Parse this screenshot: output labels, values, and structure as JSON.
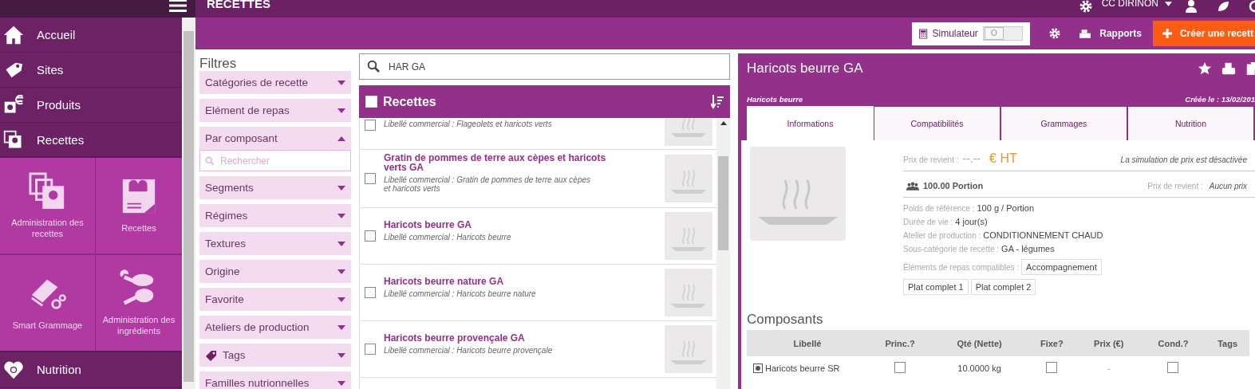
{
  "topbar": {
    "section_title": "RECETTES",
    "site": "CC DIRINON"
  },
  "sidebar": {
    "items": [
      {
        "label": "Accueil",
        "selected": false
      },
      {
        "label": "Sites",
        "selected": false
      },
      {
        "label": "Produits",
        "selected": false
      },
      {
        "label": "Recettes",
        "selected": true
      }
    ],
    "tiles": [
      {
        "label": "Administration des recettes"
      },
      {
        "label": "Recettes"
      },
      {
        "label": "Smart Grammage"
      },
      {
        "label": "Administration des ingrédients"
      }
    ],
    "bottom_items": [
      {
        "label": "Nutrition",
        "selected": false
      }
    ]
  },
  "toolbar": {
    "simulator": {
      "label": "Simulateur",
      "toggle_text": "O",
      "on": false
    },
    "reports": "Rapports",
    "create": "Créer une recett"
  },
  "filters": {
    "title": "Filtres",
    "items": [
      {
        "kind": "plain",
        "label": "Catégories de recette",
        "expanded": false
      },
      {
        "kind": "plain",
        "label": "Elément de repas",
        "expanded": false
      },
      {
        "kind": "plain",
        "label": "Par composant",
        "expanded": true,
        "search_placeholder": "Rechercher"
      },
      {
        "kind": "plain",
        "label": "Segments",
        "expanded": false
      },
      {
        "kind": "plain",
        "label": "Régimes",
        "expanded": false
      },
      {
        "kind": "plain",
        "label": "Textures",
        "expanded": false
      },
      {
        "kind": "plain",
        "label": "Origine",
        "expanded": false
      },
      {
        "kind": "plain",
        "label": "Favorite",
        "expanded": false
      },
      {
        "kind": "plain",
        "label": "Ateliers de production",
        "expanded": false
      },
      {
        "kind": "tag",
        "label": "Tags",
        "expanded": false
      },
      {
        "kind": "plain",
        "label": "Familles nutrionnelles",
        "expanded": false
      }
    ]
  },
  "recipes": {
    "search_value": "HAR GA",
    "title": "Recettes",
    "all_checked": false,
    "rows": [
      {
        "kind": "partial",
        "subtitle": "Libellé commercial : Flageolets et haricots verts",
        "checked": false
      },
      {
        "kind": "full",
        "name": "Gratin de pommes de terre aux cèpes et haricots verts GA",
        "subtitle": "Libellé commercial : Gratin de pommes de terre aux cèpes et haricots verts",
        "checked": false
      },
      {
        "kind": "full",
        "name": "Haricots beurre GA",
        "subtitle": "Libellé commercial : Haricots beurre",
        "checked": false
      },
      {
        "kind": "full",
        "name": "Haricots beurre nature GA",
        "subtitle": "Libellé commercial : Haricots beurre nature",
        "checked": false
      },
      {
        "kind": "full",
        "name": "Haricots beurre provençale GA",
        "subtitle": "Libellé commercial : Haricots beurre provençale",
        "checked": false
      }
    ]
  },
  "detail": {
    "title": "Haricots beurre GA",
    "subtitle": "Haricots beurre",
    "created": "Créée le : 13/02/201",
    "tabs": [
      {
        "label": "Informations",
        "selected": true
      },
      {
        "label": "Compatibilités",
        "selected": false
      },
      {
        "label": "Grammages",
        "selected": false
      },
      {
        "label": "Nutrition",
        "selected": false
      }
    ],
    "cost_label": "Prix de revient :",
    "cost_value": "--.--",
    "cost_unit": "€ HT",
    "simulation_note": "La simulation de prix est désactivée",
    "portion": "100.00 Portion",
    "portion_cost_label": "Prix de revient :",
    "portion_cost_value": "Aucun prix",
    "fields": [
      {
        "label": "Poids de référence :",
        "value": "100 g / Portion"
      },
      {
        "label": "Durée de vie :",
        "value": "4 jour(s)"
      },
      {
        "label": "Atelier de production :",
        "value": "CONDITIONNEMENT CHAUD"
      },
      {
        "label": "Sous-catégorie de recette :",
        "value": "GA - légumes"
      }
    ],
    "meal_label": "Éléments de repas compatibles :",
    "meal_tags": [
      "Accompagnement",
      "Plat complet 1",
      "Plat complet 2"
    ],
    "components_title": "Composants",
    "table": {
      "columns": [
        "Libellé",
        "Princ.?",
        "Qté (Nette)",
        "Fixe?",
        "Prix (€)",
        "Cond.?",
        "Tags"
      ],
      "rows": [
        {
          "label": "Haricots beurre SR",
          "main": false,
          "qty": "10.0000  kg",
          "fixed": false,
          "price": "-",
          "cond": false
        }
      ]
    }
  }
}
